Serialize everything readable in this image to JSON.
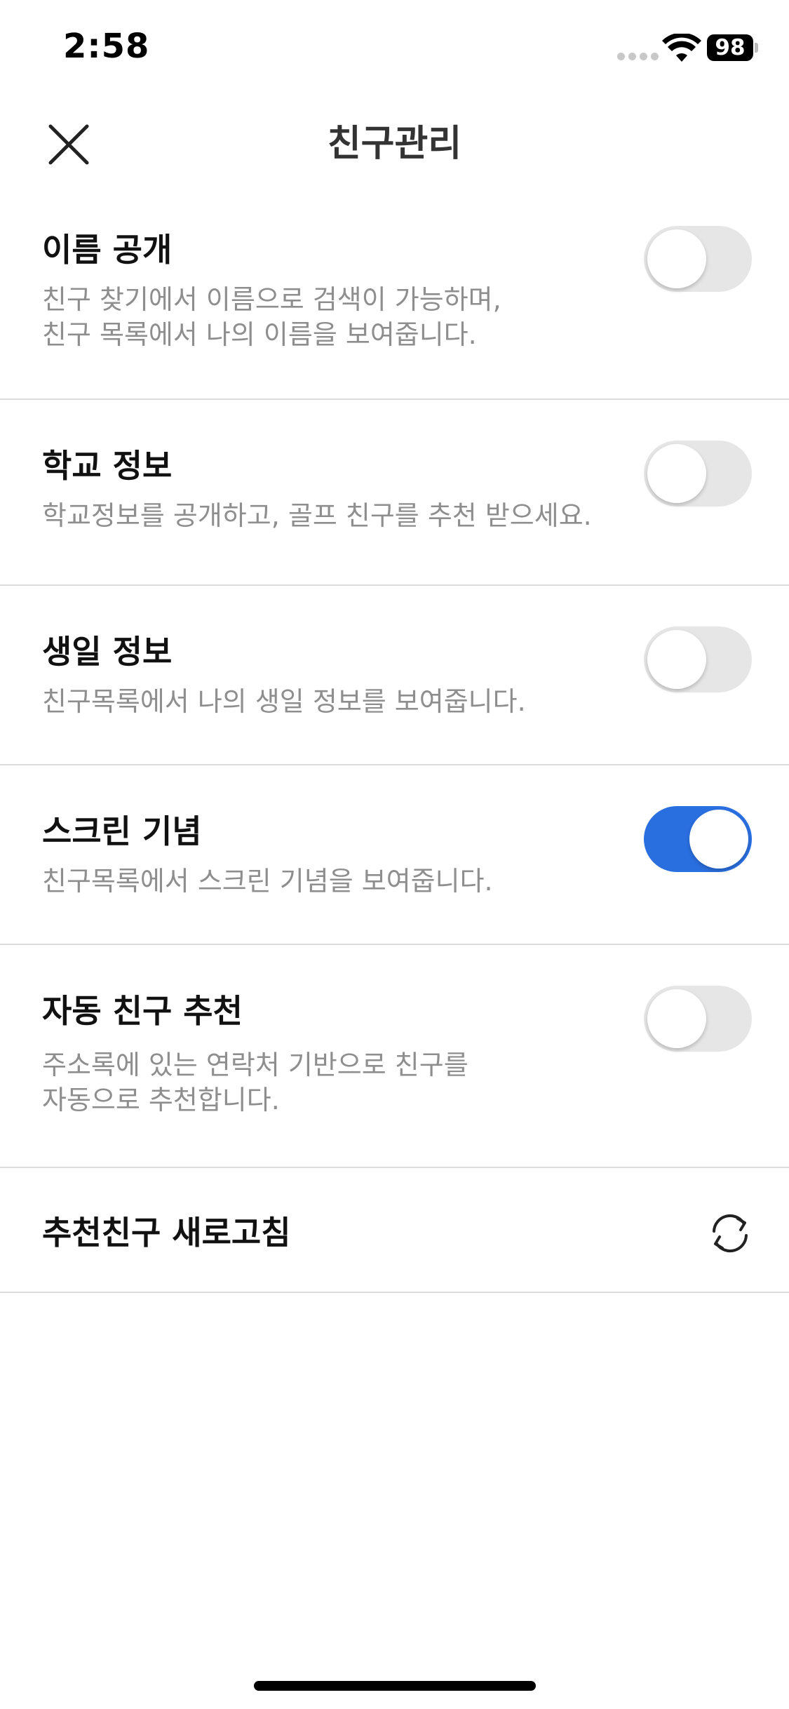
{
  "status_bar": {
    "time": "2:58",
    "battery": "98",
    "icons": [
      "signal-icon",
      "wifi-icon",
      "battery-icon"
    ]
  },
  "nav": {
    "title": "친구관리",
    "close_icon": "close-icon"
  },
  "settings": [
    {
      "title": "이름 공개",
      "description": "친구 찾기에서 이름으로 검색이 가능하며,\n친구 목록에서 나의 이름을 보여줍니다.",
      "enabled": false
    },
    {
      "title": "학교 정보",
      "description": "학교정보를 공개하고, 골프 친구를 추천 받으세요.",
      "enabled": false
    },
    {
      "title": "생일 정보",
      "description": "친구목록에서 나의 생일 정보를 보여줍니다.",
      "enabled": false
    },
    {
      "title": "스크린 기념",
      "description": "친구목록에서 스크린 기념을 보여줍니다.",
      "enabled": true
    },
    {
      "title": "자동 친구 추천",
      "description": "주소록에 있는 연락처 기반으로 친구를\n자동으로 추천합니다.",
      "enabled": false
    }
  ],
  "refresh_row": {
    "title": "추천친구 새로고침",
    "icon": "refresh-icon"
  },
  "colors": {
    "toggle_on": "#2a6fe0",
    "toggle_off": "#e6e6e6",
    "description_text": "#8e8e8e",
    "divider": "#dcdcdc"
  }
}
